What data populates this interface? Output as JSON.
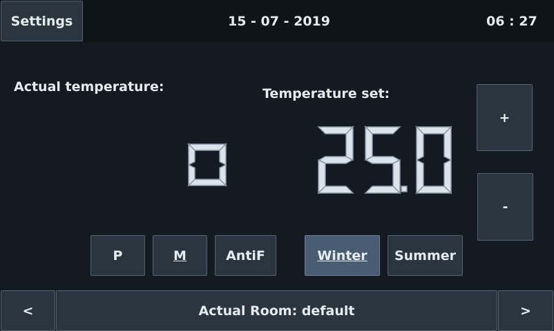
{
  "header": {
    "settings_label": "Settings",
    "date": "15 - 07 - 2019",
    "time": "06 : 27"
  },
  "actual_temperature": {
    "label": "Actual temperature:",
    "value": "0"
  },
  "temperature_set": {
    "label": "Temperature set:",
    "value": "25.0",
    "increase_label": "+",
    "decrease_label": "-"
  },
  "modes": [
    {
      "label": "P",
      "active": false,
      "underlined": false
    },
    {
      "label": "M",
      "active": false,
      "underlined": true
    },
    {
      "label": "AntiF",
      "active": false,
      "underlined": false
    }
  ],
  "seasons": [
    {
      "label": "Winter",
      "active": true,
      "underlined": true
    },
    {
      "label": "Summer",
      "active": false,
      "underlined": false
    }
  ],
  "footer": {
    "prev_label": "<",
    "room_label": "Actual Room: default",
    "next_label": ">"
  },
  "colors": {
    "background": "#141a22",
    "button": "#2b3540",
    "button_active": "#4a5c72",
    "text": "#e6ebf0"
  }
}
